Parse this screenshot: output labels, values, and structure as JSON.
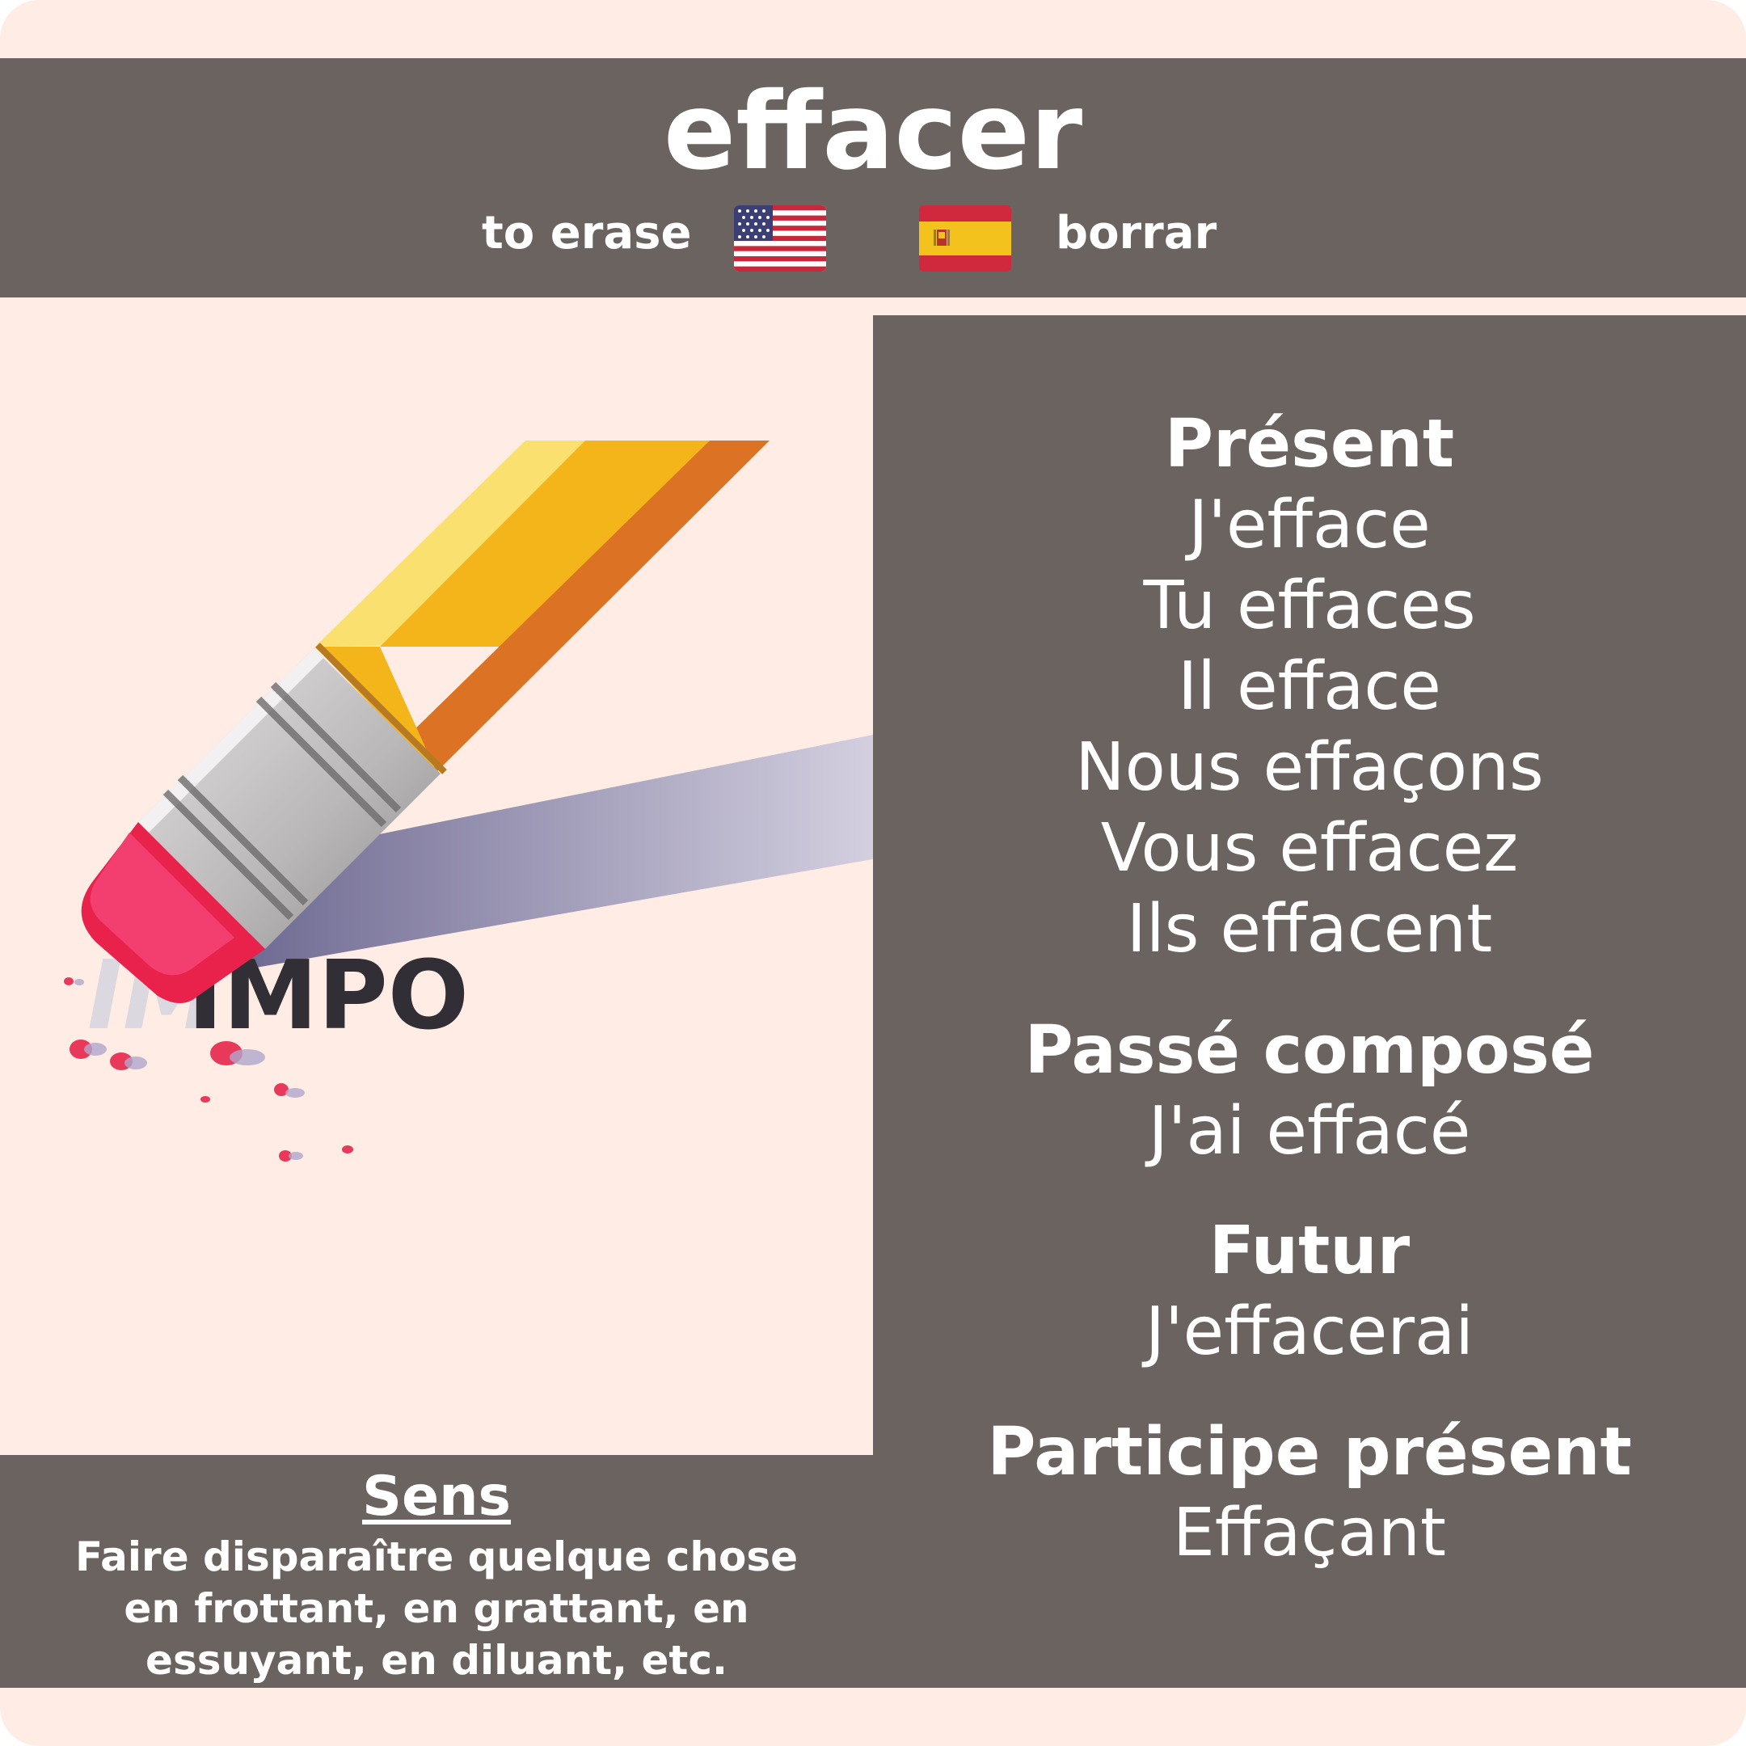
{
  "header": {
    "verb": "effacer",
    "english": "to erase",
    "spanish": "borrar",
    "english_flag_icon": "us-flag-icon",
    "spanish_flag_icon": "spain-flag-icon"
  },
  "illustration": {
    "icon": "pencil-eraser-icon",
    "text": "IMPO"
  },
  "conjugation": {
    "present_heading": "Présent",
    "present": [
      "J'efface",
      "Tu effaces",
      "Il efface",
      "Nous effaçons",
      "Vous effacez",
      "Ils effacent"
    ],
    "passe_compose_heading": "Passé composé",
    "passe_compose": "J'ai effacé",
    "futur_heading": "Futur",
    "futur": "J'effacerai",
    "participe_present_heading": "Participe présent",
    "participe_present": "Effaçant"
  },
  "sens": {
    "title": "Sens",
    "lines": [
      "Faire disparaître quelque chose",
      "en frottant, en grattant, en",
      "essuyant, en diluant, etc."
    ]
  },
  "colors": {
    "background": "#ffece4",
    "panel": "#6b6360",
    "text": "#ffffff"
  }
}
